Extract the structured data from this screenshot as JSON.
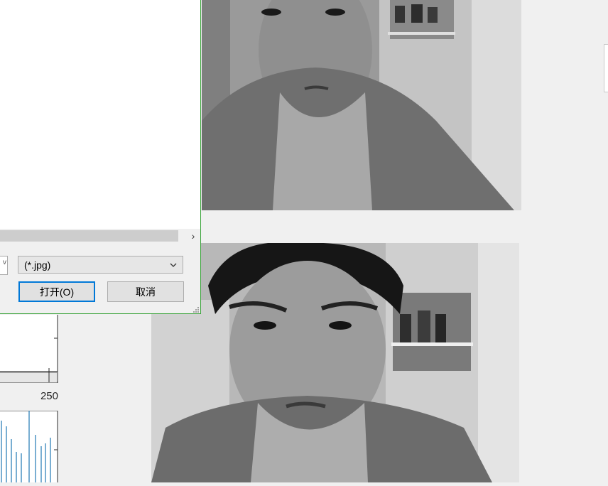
{
  "dialog": {
    "file_type": "(*.jpg)",
    "open_label": "打开(O)",
    "cancel_label": "取消"
  },
  "plot": {
    "x_tick_label": "250"
  },
  "icons": {
    "hscroll_right": "chevron-right-icon",
    "dropdown": "chevron-down-icon",
    "resize": "resize-grip-icon"
  },
  "colors": {
    "dialog_border": "#3aa43a",
    "primary_button_border": "#0078d7",
    "histogram_bars": "#1f77b4"
  }
}
